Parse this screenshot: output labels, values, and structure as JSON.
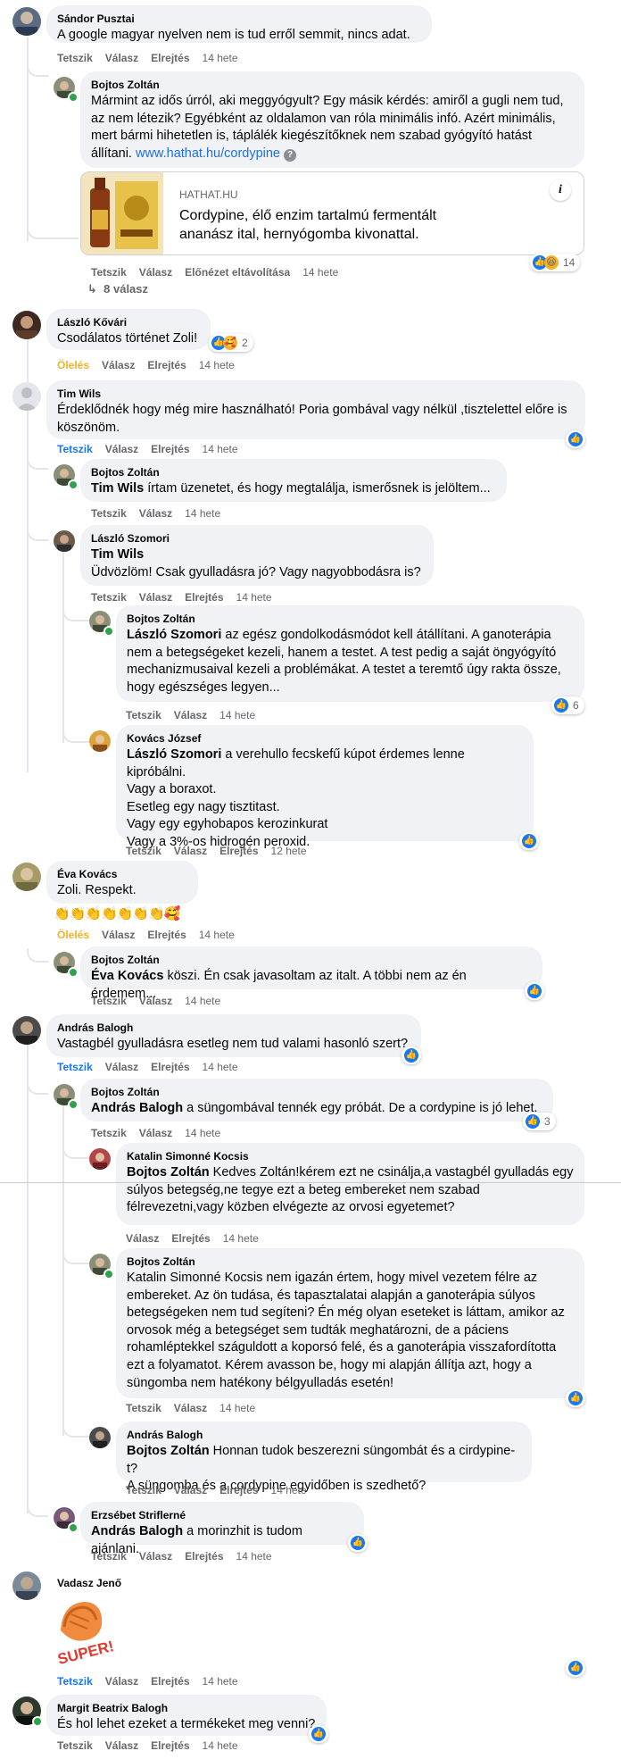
{
  "c1": {
    "author": "Sándor Pusztai",
    "text": "A google magyar nyelven nem is tud erről semmit, nincs adat.",
    "like": "Tetszik",
    "reply": "Válasz",
    "hide": "Elrejtés",
    "time": "14 hete"
  },
  "c2": {
    "author": "Bojtos Zoltán",
    "text": "Mármint az idős úrról, aki meggyógyult? Egy másik kérdés: amiről a gugli nem tud, az nem létezik? Egyébként az oldalamon van róla minimális infó. Azért minimális, mert bármi hihetetlen is, táplálék kiegészítőknek nem szabad gyógyító hatást állítani. ",
    "link": "www.hathat.hu/cordypine",
    "like": "Tetszik",
    "reply": "Válasz",
    "remove_preview": "Előnézet eltávolítása",
    "time": "14 hete",
    "reactions": "14",
    "preview": {
      "domain": "HATHAT.HU",
      "title": "Cordypine, élő enzim tartalmú fermentált ananász ital, hernyógomba kivonattal.",
      "info": "i"
    }
  },
  "c2_replies": "8 válasz",
  "c3": {
    "author": "László Kővári",
    "text": "Csodálatos történet Zoli!",
    "like": "Ölelés",
    "reply": "Válasz",
    "hide": "Elrejtés",
    "time": "14 hete",
    "reactions": "2"
  },
  "c4": {
    "author": "Tim Wils",
    "text": "Érdeklődnék hogy még mire használható! Poria gombával vagy nélkül ,tisztelettel előre is köszönöm.",
    "like": "Tetszik",
    "reply": "Válasz",
    "hide": "Elrejtés",
    "time": "14 hete"
  },
  "c5": {
    "author": "Bojtos Zoltán",
    "mention": "Tim Wils",
    "text": " írtam üzenetet, és hogy megtalálja, ismerősnek is jelöltem...",
    "like": "Tetszik",
    "reply": "Válasz",
    "time": "14 hete"
  },
  "c6": {
    "author": "László Szomori",
    "mention": "Tim Wils",
    "text": "Üdvözlöm! Csak gyulladásra jó? Vagy nagyobbodásra is?",
    "like": "Tetszik",
    "reply": "Válasz",
    "hide": "Elrejtés",
    "time": "14 hete"
  },
  "c7": {
    "author": "Bojtos Zoltán",
    "mention": "László Szomori",
    "text": " az egész gondolkodásmódot kell átállítani. A ganoterápia nem a betegségeket kezeli, hanem a testet. A test pedig a saját öngyógyító mechanizmusaival kezeli a problémákat. A testet a teremtő úgy rakta össze, hogy egészséges legyen...",
    "like": "Tetszik",
    "reply": "Válasz",
    "time": "14 hete",
    "reactions": "6"
  },
  "c8": {
    "author": "Kovács József",
    "mention": "László Szomori",
    "text": " a verehullo fecskefű kúpot érdemes lenne kipróbálni.\nVagy a boraxot.\nEsetleg egy nagy tisztitast.\nVagy egy egyhobapos kerozinkurat\nVagy a 3%-os hidrogén peroxid.",
    "like": "Tetszik",
    "reply": "Válasz",
    "hide": "Elrejtés",
    "time": "12 hete"
  },
  "c9": {
    "author": "Éva Kovács",
    "text": "Zoli. Respekt.",
    "emojis": "👏👏👏👏👏👏👏🥰",
    "like": "Ölelés",
    "reply": "Válasz",
    "hide": "Elrejtés",
    "time": "14 hete"
  },
  "c10": {
    "author": "Bojtos Zoltán",
    "mention": "Éva Kovács",
    "text": " köszi. Én csak javasoltam az italt. A többi nem az én érdemem...",
    "like": "Tetszik",
    "reply": "Válasz",
    "time": "14 hete"
  },
  "c11": {
    "author": "András Balogh",
    "text": "Vastagbél gyulladásra esetleg nem tud valami hasonló szert?",
    "like": "Tetszik",
    "reply": "Válasz",
    "hide": "Elrejtés",
    "time": "14 hete"
  },
  "c12": {
    "author": "Bojtos Zoltán",
    "mention": "András Balogh",
    "text": " a süngombával tennék egy próbát. De a cordypine is jó lehet.",
    "like": "Tetszik",
    "reply": "Válasz",
    "time": "14 hete",
    "reactions": "3"
  },
  "c13": {
    "author": "Katalin Simonné Kocsis",
    "mention": "Bojtos Zoltán",
    "text": " Kedves Zoltán!kérem ezt ne csinálja,a vastagbél gyulladás egy súlyos betegség,ne tegye ezt a beteg embereket nem szabad félrevezetni,vagy közben elvégezte az orvosi egyetemet?",
    "reply": "Válasz",
    "hide": "Elrejtés",
    "time": "14 hete"
  },
  "c14": {
    "author": "Bojtos Zoltán",
    "text": "Katalin Simonné Kocsis nem igazán értem, hogy mivel vezetem félre az embereket. Az ön tudása, és tapasztalatai alapján a ganoterápia súlyos betegségeken nem tud segíteni? Én még olyan eseteket is láttam, amikor az orvosok még a betegséget sem tudták meghatározni, de a páciens rohamléptekkel száguldott a koporsó felé, és a ganoterápia visszafordította ezt a folyamatot. Kérem avasson be, hogy mi alapján állítja azt, hogy a süngomba nem hatékony bélgyulladás esetén!",
    "like": "Tetszik",
    "reply": "Válasz",
    "time": "14 hete"
  },
  "c15": {
    "author": "András Balogh",
    "mention": "Bojtos Zoltán",
    "text": " Honnan tudok beszerezni süngombát és a cirdypine-t?\nA süngomba és a cordypine egyidőben is szedhető?",
    "like": "Tetszik",
    "reply": "Válasz",
    "hide": "Elrejtés",
    "time": "14 hete"
  },
  "c16": {
    "author": "Erzsébet Striflerné",
    "mention": "András Balogh",
    "text": " a morinzhit is tudom ajánlani.",
    "like": "Tetszik",
    "reply": "Válasz",
    "hide": "Elrejtés",
    "time": "14 hete"
  },
  "c17": {
    "author": "Vadasz Jenő",
    "sticker": "SUPER!",
    "like": "Tetszik",
    "reply": "Válasz",
    "hide": "Elrejtés",
    "time": "14 hete"
  },
  "c18": {
    "author": "Margit Beatrix Balogh",
    "text": "És hol lehet ezeket a termékeket meg venni?",
    "like": "Tetszik",
    "reply": "Válasz",
    "hide": "Elrejtés",
    "time": "14 hete"
  },
  "colors": {
    "bubble": "#f0f2f5",
    "link": "#216fdb",
    "like_blue": "#1877f2",
    "care_yellow": "#f7b125",
    "muted": "#65676b",
    "online": "#31a24c"
  },
  "icons": [
    "avatar",
    "like-reaction-icon",
    "haha-reaction-icon",
    "care-reaction-icon",
    "info-icon",
    "reply-arrow-icon",
    "super-sticker"
  ]
}
